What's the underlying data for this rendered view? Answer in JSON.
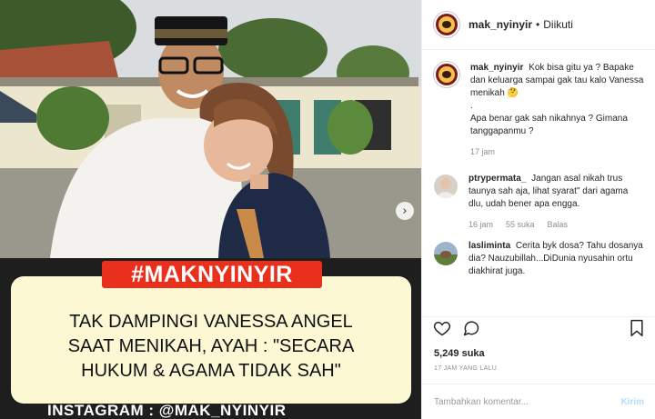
{
  "post": {
    "banner_hashtag": "#MAKNYINYIR",
    "headline": "TAK DAMPINGI VANESSA ANGEL SAAT MENIKAH, AYAH : \"SECARA HUKUM & AGAMA TIDAK SAH\"",
    "instagram_line": "INSTAGRAM : @MAK_NYINYIR"
  },
  "header": {
    "username": "mak_nyinyir",
    "dot": "•",
    "follow_status": "Diikuti"
  },
  "caption": {
    "username": "mak_nyinyir",
    "line1": "Kok bisa gitu ya ? Bapake dan keluarga sampai gak tau kalo Vanessa menikah 🤔",
    "line2": ".",
    "line3": "Apa benar gak sah nikahnya ? Gimana tanggapanmu ?",
    "time": "17 jam"
  },
  "comments": [
    {
      "username": "ptrypermata_",
      "text": "Jangan asal nikah trus taunya sah aja, lihat syarat\" dari agama dlu, udah bener apa engga.",
      "time": "16 jam",
      "likes": "55 suka",
      "reply": "Balas"
    },
    {
      "username": "lasliminta",
      "text": "Cerita byk dosa? Tahu dosanya dia? Nauzubillah...DiDunia nyusahin ortu diakhirat juga.",
      "time": "",
      "likes": "",
      "reply": ""
    }
  ],
  "stats": {
    "likes_count": "5,249",
    "likes_label": "suka",
    "posted_ago": "17 JAM YANG LALU"
  },
  "comment_input": {
    "placeholder": "Tambahkan komentar...",
    "send_label": "Kirim"
  },
  "colors": {
    "hashtag_red": "#e8301c",
    "headline_bg": "#fbf8d3",
    "banner_bg": "#1e1e1e",
    "send_disabled": "#b3dbff"
  },
  "icons": {
    "like": "heart-icon",
    "comment": "comment-bubble-icon",
    "save": "bookmark-icon",
    "next": "chevron-right-icon"
  }
}
